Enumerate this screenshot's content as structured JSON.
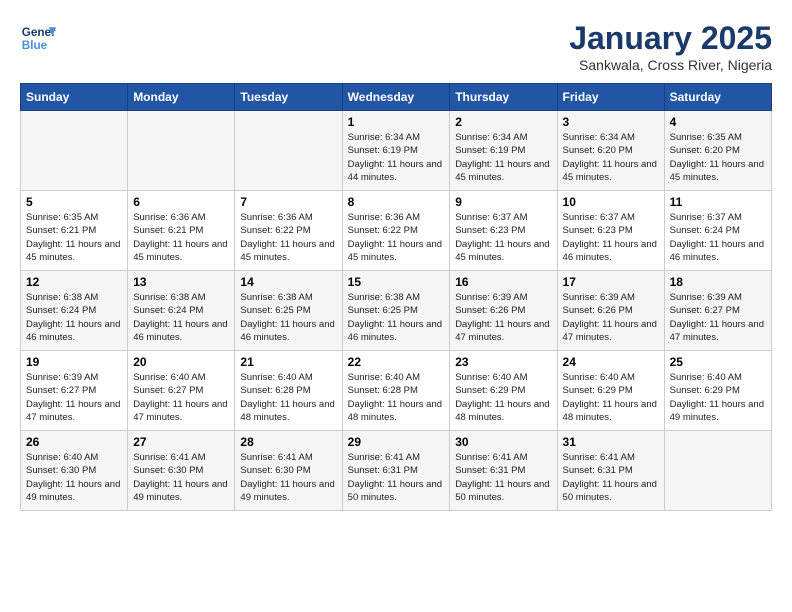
{
  "header": {
    "logo_line1": "General",
    "logo_line2": "Blue",
    "main_title": "January 2025",
    "subtitle": "Sankwala, Cross River, Nigeria"
  },
  "days_of_week": [
    "Sunday",
    "Monday",
    "Tuesday",
    "Wednesday",
    "Thursday",
    "Friday",
    "Saturday"
  ],
  "weeks": [
    [
      {
        "day": "",
        "info": ""
      },
      {
        "day": "",
        "info": ""
      },
      {
        "day": "",
        "info": ""
      },
      {
        "day": "1",
        "info": "Sunrise: 6:34 AM\nSunset: 6:19 PM\nDaylight: 11 hours\nand 44 minutes."
      },
      {
        "day": "2",
        "info": "Sunrise: 6:34 AM\nSunset: 6:19 PM\nDaylight: 11 hours\nand 45 minutes."
      },
      {
        "day": "3",
        "info": "Sunrise: 6:34 AM\nSunset: 6:20 PM\nDaylight: 11 hours\nand 45 minutes."
      },
      {
        "day": "4",
        "info": "Sunrise: 6:35 AM\nSunset: 6:20 PM\nDaylight: 11 hours\nand 45 minutes."
      }
    ],
    [
      {
        "day": "5",
        "info": "Sunrise: 6:35 AM\nSunset: 6:21 PM\nDaylight: 11 hours\nand 45 minutes."
      },
      {
        "day": "6",
        "info": "Sunrise: 6:36 AM\nSunset: 6:21 PM\nDaylight: 11 hours\nand 45 minutes."
      },
      {
        "day": "7",
        "info": "Sunrise: 6:36 AM\nSunset: 6:22 PM\nDaylight: 11 hours\nand 45 minutes."
      },
      {
        "day": "8",
        "info": "Sunrise: 6:36 AM\nSunset: 6:22 PM\nDaylight: 11 hours\nand 45 minutes."
      },
      {
        "day": "9",
        "info": "Sunrise: 6:37 AM\nSunset: 6:23 PM\nDaylight: 11 hours\nand 45 minutes."
      },
      {
        "day": "10",
        "info": "Sunrise: 6:37 AM\nSunset: 6:23 PM\nDaylight: 11 hours\nand 46 minutes."
      },
      {
        "day": "11",
        "info": "Sunrise: 6:37 AM\nSunset: 6:24 PM\nDaylight: 11 hours\nand 46 minutes."
      }
    ],
    [
      {
        "day": "12",
        "info": "Sunrise: 6:38 AM\nSunset: 6:24 PM\nDaylight: 11 hours\nand 46 minutes."
      },
      {
        "day": "13",
        "info": "Sunrise: 6:38 AM\nSunset: 6:24 PM\nDaylight: 11 hours\nand 46 minutes."
      },
      {
        "day": "14",
        "info": "Sunrise: 6:38 AM\nSunset: 6:25 PM\nDaylight: 11 hours\nand 46 minutes."
      },
      {
        "day": "15",
        "info": "Sunrise: 6:38 AM\nSunset: 6:25 PM\nDaylight: 11 hours\nand 46 minutes."
      },
      {
        "day": "16",
        "info": "Sunrise: 6:39 AM\nSunset: 6:26 PM\nDaylight: 11 hours\nand 47 minutes."
      },
      {
        "day": "17",
        "info": "Sunrise: 6:39 AM\nSunset: 6:26 PM\nDaylight: 11 hours\nand 47 minutes."
      },
      {
        "day": "18",
        "info": "Sunrise: 6:39 AM\nSunset: 6:27 PM\nDaylight: 11 hours\nand 47 minutes."
      }
    ],
    [
      {
        "day": "19",
        "info": "Sunrise: 6:39 AM\nSunset: 6:27 PM\nDaylight: 11 hours\nand 47 minutes."
      },
      {
        "day": "20",
        "info": "Sunrise: 6:40 AM\nSunset: 6:27 PM\nDaylight: 11 hours\nand 47 minutes."
      },
      {
        "day": "21",
        "info": "Sunrise: 6:40 AM\nSunset: 6:28 PM\nDaylight: 11 hours\nand 48 minutes."
      },
      {
        "day": "22",
        "info": "Sunrise: 6:40 AM\nSunset: 6:28 PM\nDaylight: 11 hours\nand 48 minutes."
      },
      {
        "day": "23",
        "info": "Sunrise: 6:40 AM\nSunset: 6:29 PM\nDaylight: 11 hours\nand 48 minutes."
      },
      {
        "day": "24",
        "info": "Sunrise: 6:40 AM\nSunset: 6:29 PM\nDaylight: 11 hours\nand 48 minutes."
      },
      {
        "day": "25",
        "info": "Sunrise: 6:40 AM\nSunset: 6:29 PM\nDaylight: 11 hours\nand 49 minutes."
      }
    ],
    [
      {
        "day": "26",
        "info": "Sunrise: 6:40 AM\nSunset: 6:30 PM\nDaylight: 11 hours\nand 49 minutes."
      },
      {
        "day": "27",
        "info": "Sunrise: 6:41 AM\nSunset: 6:30 PM\nDaylight: 11 hours\nand 49 minutes."
      },
      {
        "day": "28",
        "info": "Sunrise: 6:41 AM\nSunset: 6:30 PM\nDaylight: 11 hours\nand 49 minutes."
      },
      {
        "day": "29",
        "info": "Sunrise: 6:41 AM\nSunset: 6:31 PM\nDaylight: 11 hours\nand 50 minutes."
      },
      {
        "day": "30",
        "info": "Sunrise: 6:41 AM\nSunset: 6:31 PM\nDaylight: 11 hours\nand 50 minutes."
      },
      {
        "day": "31",
        "info": "Sunrise: 6:41 AM\nSunset: 6:31 PM\nDaylight: 11 hours\nand 50 minutes."
      },
      {
        "day": "",
        "info": ""
      }
    ]
  ]
}
